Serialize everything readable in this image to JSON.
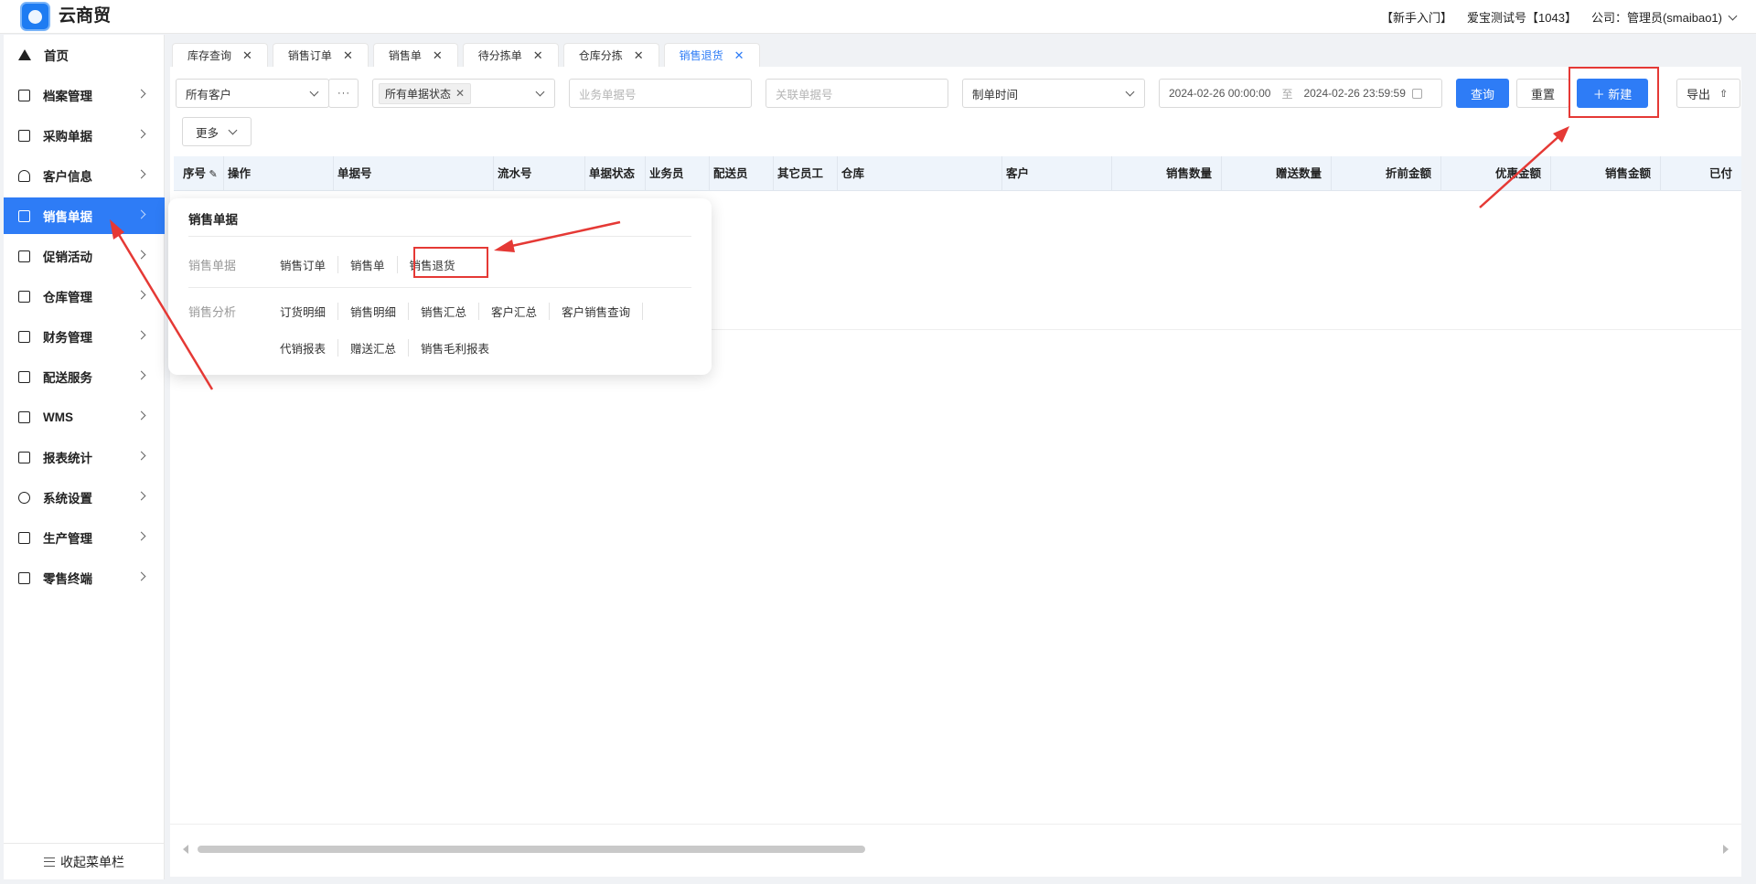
{
  "app": {
    "name": "云商贸"
  },
  "topbar": {
    "guide": "【新手入门】",
    "account": "爱宝测试号【1043】",
    "company": "公司：管理员(smaibao1)"
  },
  "sidebar": {
    "items": [
      {
        "label": "首页",
        "icon": "home-icon"
      },
      {
        "label": "档案管理",
        "icon": "archive-icon"
      },
      {
        "label": "采购单据",
        "icon": "document-icon"
      },
      {
        "label": "客户信息",
        "icon": "user-icon"
      },
      {
        "label": "销售单据",
        "icon": "chart-icon"
      },
      {
        "label": "促销活动",
        "icon": "megaphone-icon"
      },
      {
        "label": "仓库管理",
        "icon": "warehouse-icon"
      },
      {
        "label": "财务管理",
        "icon": "finance-icon"
      },
      {
        "label": "配送服务",
        "icon": "cart-icon"
      },
      {
        "label": "WMS",
        "icon": "car-icon"
      },
      {
        "label": "报表统计",
        "icon": "bar-chart-icon"
      },
      {
        "label": "系统设置",
        "icon": "gear-icon"
      },
      {
        "label": "生产管理",
        "icon": "network-icon"
      },
      {
        "label": "零售终端",
        "icon": "bag-icon"
      }
    ],
    "active": "销售单据",
    "collapse_label": "收起菜单栏"
  },
  "tabs": [
    {
      "label": "库存查询"
    },
    {
      "label": "销售订单"
    },
    {
      "label": "销售单"
    },
    {
      "label": "待分拣单"
    },
    {
      "label": "仓库分拣"
    },
    {
      "label": "销售退货"
    }
  ],
  "active_tab": "销售退货",
  "filters": {
    "customer": "所有客户",
    "more_dots": "···",
    "status_tag": "所有单据状态",
    "order_no_placeholder": "业务单据号",
    "related_no_placeholder": "关联单据号",
    "time_type": "制单时间",
    "date_start": "2024-02-26 00:00:00",
    "date_sep": "至",
    "date_end": "2024-02-26 23:59:59",
    "more": "更多"
  },
  "buttons": {
    "query": "查询",
    "reset": "重置",
    "create": "＋ 新建",
    "export": "导出"
  },
  "table": {
    "columns": [
      "序号",
      "操作",
      "单据号",
      "流水号",
      "单据状态",
      "业务员",
      "配送员",
      "其它员工",
      "仓库",
      "客户",
      "销售数量",
      "赠送数量",
      "折前金额",
      "优惠金额",
      "销售金额",
      "已付"
    ]
  },
  "popup": {
    "title": "销售单据",
    "rows": [
      {
        "label": "销售单据",
        "links": [
          "销售订单",
          "销售单",
          "销售退货"
        ]
      },
      {
        "label": "销售分析",
        "links": [
          "订货明细",
          "销售明细",
          "销售汇总",
          "客户汇总",
          "客户销售查询"
        ]
      },
      {
        "label": "",
        "links": [
          "代销报表",
          "赠送汇总",
          "销售毛利报表"
        ]
      }
    ]
  },
  "colors": {
    "primary": "#2e7cf6",
    "annotation": "#e53935"
  }
}
